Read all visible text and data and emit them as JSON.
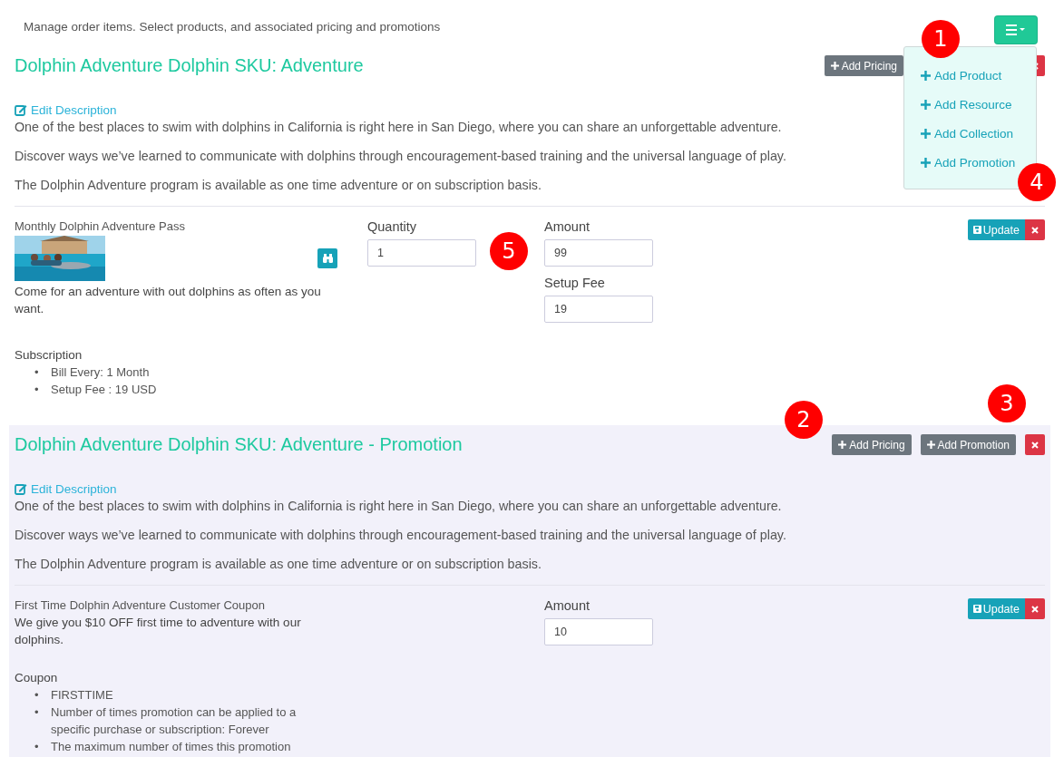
{
  "intro": "Manage order items. Select products, and associated pricing and promotions",
  "menu_button": {
    "expanded": true
  },
  "menu": [
    {
      "label": "Add Product"
    },
    {
      "label": "Add Resource"
    },
    {
      "label": "Add Collection"
    },
    {
      "label": "Add Promotion"
    }
  ],
  "sections": [
    {
      "kind": "product",
      "title": "Dolphin Adventure Dolphin SKU: Adventure",
      "buttons": [
        {
          "kind": "pricing",
          "label": "Add Pricing"
        },
        {
          "kind": "delete"
        }
      ],
      "edit_link": "Edit Description",
      "paragraphs": [
        "One of the best places to swim with dolphins in California is right here in San Diego, where you can share an unforgettable adventure.",
        "Discover ways we’ve learned to communicate with dolphins through encouragement-based training and the universal language of play.",
        "The Dolphin Adventure program is available as one time adventure or on subscription basis."
      ],
      "item": {
        "name": "Monthly Dolphin Adventure Pass",
        "description": "Come for an adventure with out dolphins as often as you want.",
        "quantity": {
          "label": "Quantity",
          "value": "1"
        },
        "prices": [
          {
            "label": "Amount",
            "value": "99"
          },
          {
            "label": "Setup Fee",
            "value": "19"
          }
        ],
        "update": "Update",
        "details_heading": "Subscription",
        "details": [
          {
            "marker": "•",
            "text": "Bill Every: 1 Month"
          },
          {
            "marker": "•",
            "text": "Setup Fee : 19 USD"
          }
        ]
      }
    },
    {
      "kind": "promotion",
      "title": "Dolphin Adventure Dolphin SKU: Adventure - Promotion",
      "buttons": [
        {
          "kind": "pricing",
          "label": "Add Pricing"
        },
        {
          "kind": "promotion",
          "label": "Add Promotion"
        },
        {
          "kind": "delete"
        }
      ],
      "edit_link": "Edit Description",
      "paragraphs": [
        "One of the best places to swim with dolphins in California is right here in San Diego, where you can share an unforgettable adventure.",
        "Discover ways we’ve learned to communicate with dolphins through encouragement-based training and the universal language of play.",
        "The Dolphin Adventure program is available as one time adventure or on subscription basis."
      ],
      "item": {
        "name": "First Time Dolphin Adventure Customer Coupon",
        "description": "We give you $10 OFF first time to adventure with our dolphins.",
        "prices": [
          {
            "label": "Amount",
            "value": "10"
          }
        ],
        "update": "Update",
        "details_heading": "Coupon",
        "details": [
          {
            "marker": "•",
            "text": "FIRSTTIME"
          },
          {
            "marker": "•",
            "text": "Number of times promotion can be applied to a specific purchase or subscription: Forever"
          },
          {
            "marker": "•",
            "text": "The maximum number of times this promotion"
          }
        ]
      }
    }
  ],
  "annotations": [
    "1",
    "2",
    "3",
    "4",
    "5"
  ]
}
